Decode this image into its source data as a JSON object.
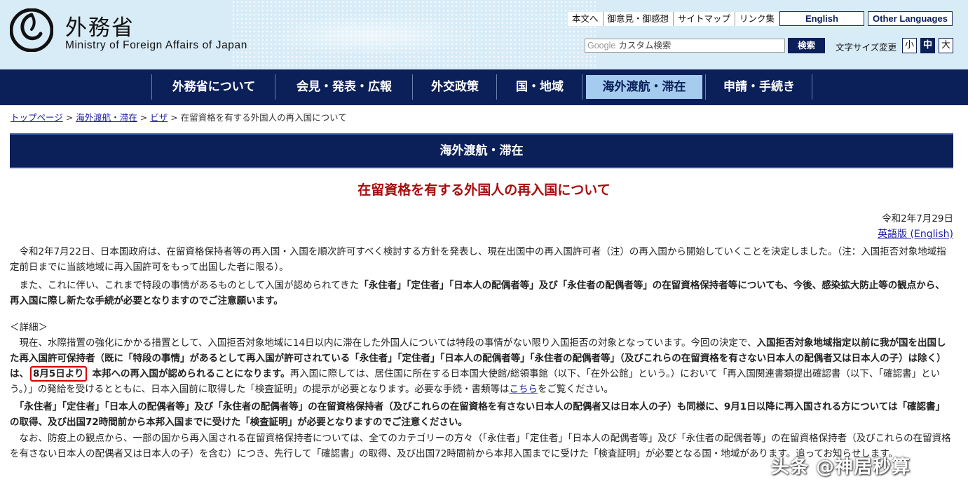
{
  "header": {
    "logo_jp": "外務省",
    "logo_en": "Ministry of Foreign Affairs of Japan",
    "util_links": [
      "本文へ",
      "御意見・御感想",
      "サイトマップ",
      "リンク集"
    ],
    "english_label": "English",
    "other_languages_label": "Other Languages",
    "search_google": "Google",
    "search_placeholder": "カスタム検索",
    "search_button": "検索",
    "fontsize_label": "文字サイズ変更",
    "fontsize_small": "小",
    "fontsize_mid": "中",
    "fontsize_large": "大"
  },
  "nav": {
    "items": [
      "外務省について",
      "会見・発表・広報",
      "外交政策",
      "国・地域",
      "海外渡航・滞在",
      "申請・手続き"
    ],
    "active_index": 4
  },
  "breadcrumb": {
    "items": [
      "トップページ",
      "海外渡航・滞在",
      "ビザ"
    ],
    "separator": ">",
    "current": "在留資格を有する外国人の再入国について"
  },
  "section_banner": "海外渡航・滞在",
  "page": {
    "title": "在留資格を有する外国人の再入国について",
    "date": "令和2年7月29日",
    "english_link": "英語版 (English)"
  },
  "body": {
    "p1": "令和2年7月22日、日本国政府は、在留資格保持者等の再入国・入国を順次許可すべく検討する方針を発表し、現在出国中の再入国許可者（注）の再入国から開始していくことを決定しました。（注：入国拒否対象地域指定前日までに当該地域に再入国許可をもって出国した者に限る）。",
    "p2_prefix": "また、これに伴い、これまで特段の事情があるものとして入国が認められてきた",
    "p2_bold": "「永住者」「定住者」「日本人の配偶者等」及び「永住者の配偶者等」の在留資格保持者等についても、今後、感染拡大防止等の観点から、再入国に際し新たな手続が必要となりますのでご注意願います。",
    "detail_heading": "＜詳細＞",
    "p3_a": "現在、水際措置の強化にかかる措置として、入国拒否対象地域に14日以内に滞在した外国人については特段の事情がない限り入国拒否の対象となっています。今回の決定で、",
    "p3_bold": "入国拒否対象地域指定以前に我が国を出国した再入国許可保持者（既に「特段の事情」があるとして再入国が許可されている「永住者」「定住者」「日本人の配偶者等」「永住者の配偶者等」（及びこれらの在留資格を有さない日本人の配偶者又は日本人の子）は除く）は、",
    "p3_highlight": "8月5日より",
    "p3_bold2": "本邦への再入国が認められることになります。",
    "p3_b": "再入国に際しては、居住国に所在する日本国大使館/総領事館（以下、「在外公館」という。）において「再入国関連書類提出確認書（以下、「確認書」という。）」の発給を受けるとともに、日本入国前に取得した「検査証明」の提示が必要となります。必要な手続・書類等は",
    "p3_link": "こちら",
    "p3_c": "をご覧ください。",
    "p4_bold": "「永住者」「定住者」「日本人の配偶者等」及び「永住者の配偶者等」の在留資格保持者（及びこれらの在留資格を有さない日本人の配偶者又は日本人の子）も同様に、9月1日以降に再入国される方については「確認書」の取得、及び出国72時間前から本邦入国までに受けた「検査証明」が必要となりますのでご注意ください。",
    "p5": "なお、防疫上の観点から、一部の国から再入国される在留資格保持者については、全てのカテゴリーの方々（「永住者」「定住者」「日本人の配偶者等」及び「永住者の配偶者等」の在留資格保持者（及びこれらの在留資格を有さない日本人の配偶者又は日本人の子）を含む）につき、先行して「確認書」の取得、及び出国72時間前から本邦入国までに受けた「検査証明」が必要となる国・地域があります。追ってお知らせします。"
  },
  "watermark": "头条 @神居秒算"
}
